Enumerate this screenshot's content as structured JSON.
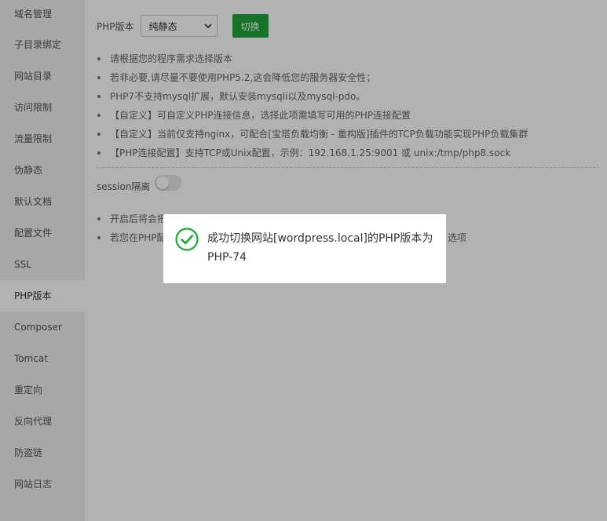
{
  "sidebar": {
    "items": [
      {
        "label": "域名管理"
      },
      {
        "label": "子目录绑定"
      },
      {
        "label": "网站目录"
      },
      {
        "label": "访问限制"
      },
      {
        "label": "流量限制"
      },
      {
        "label": "伪静态"
      },
      {
        "label": "默认文档"
      },
      {
        "label": "配置文件"
      },
      {
        "label": "SSL"
      },
      {
        "label": "PHP版本"
      },
      {
        "label": "Composer"
      },
      {
        "label": "Tomcat"
      },
      {
        "label": "重定向"
      },
      {
        "label": "反向代理"
      },
      {
        "label": "防盗链"
      },
      {
        "label": "网站日志"
      }
    ],
    "active": "PHP版本"
  },
  "php": {
    "version_label": "PHP版本",
    "selected_version": "纯静态",
    "switch_button": "切换",
    "tips": [
      "请根据您的程序需求选择版本",
      "若非必要,请尽量不要使用PHP5.2,这会降低您的服务器安全性；",
      "PHP7不支持mysql扩展，默认安装mysqli以及mysql-pdo。",
      "【自定义】可自定义PHP连接信息，选择此项需填写可用的PHP连接配置",
      "【自定义】当前仅支持nginx，可配合[宝塔负载均衡 - 重构版]插件的TCP负载功能实现PHP负载集群",
      "【PHP连接配置】支持TCP或Unix配置，示例：192.168.1.25:9001 或 unix:/tmp/php8.sock"
    ]
  },
  "session": {
    "label": "session隔离",
    "enabled": false,
    "tips": [
      "开启后将会把",
      "若您在PHP配"
    ],
    "tip_tail": "选项"
  },
  "toast": {
    "message": "成功切换网站[wordpress.local]的PHP版本为PHP-74",
    "icon": "check-circle-icon",
    "color": "#20a53a"
  },
  "colors": {
    "accent": "#20a53a",
    "overlay": "rgba(0,0,0,0.3)"
  }
}
